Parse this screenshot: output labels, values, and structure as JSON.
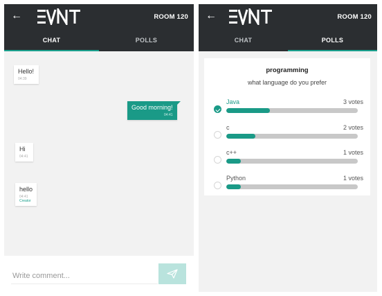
{
  "header": {
    "back_icon": "←",
    "logo_text": "EVNT",
    "room": "ROOM 120"
  },
  "tabs": {
    "chat": "CHAT",
    "polls": "POLLS"
  },
  "chat": {
    "messages": [
      {
        "text": "Hello!",
        "time": "04:39",
        "direction": "in"
      },
      {
        "text": "Good morning!",
        "time": "04:41",
        "direction": "out"
      },
      {
        "text": "Hi",
        "time": "04:41",
        "direction": "in"
      },
      {
        "text": "hello",
        "time": "04:41",
        "direction": "in",
        "role": "Creator"
      }
    ],
    "composer": {
      "placeholder": "Write comment..."
    }
  },
  "poll": {
    "title": "programming",
    "question": "what language do you prefer",
    "options": [
      {
        "name": "Java",
        "votes": "3 votes",
        "share": 0.33,
        "selected": true
      },
      {
        "name": "c",
        "votes": "2 votes",
        "share": 0.22,
        "selected": false
      },
      {
        "name": "c++",
        "votes": "1 votes",
        "share": 0.11,
        "selected": false
      },
      {
        "name": "Python",
        "votes": "1 votes",
        "share": 0.11,
        "selected": false
      }
    ]
  },
  "colors": {
    "accent": "#1a9a87",
    "topbar": "#2b2e31",
    "send_bg": "#b9e3dd"
  },
  "icons": {
    "back": "arrow-left-icon",
    "send": "send-icon",
    "check": "check-icon"
  }
}
